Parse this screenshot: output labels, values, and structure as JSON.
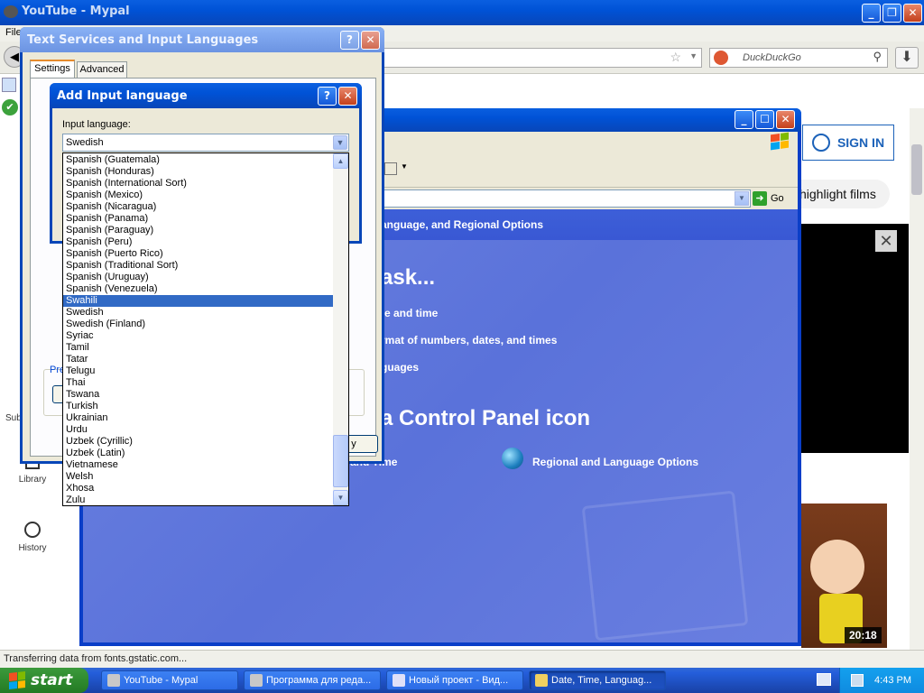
{
  "browser": {
    "title": "YouTube - Mypal",
    "menu_file": "File",
    "search_placeholder": "DuckDuckGo",
    "status": "Transferring data from fonts.gstatic.com...",
    "sign_in": "SIGN IN",
    "chip": "highlight films",
    "video_duration": "20:18",
    "nav": {
      "subscriptions": "Sub",
      "library": "Library",
      "history": "History"
    }
  },
  "control_panel": {
    "breadcrumb": "anguage, and Regional Options",
    "go": "Go",
    "heading_task": "ask...",
    "task_link_1": "te and time",
    "task_link_2": "rmat of numbers, dates, and times",
    "task_link_3": "guages",
    "heading_icon": "a Control Panel icon",
    "icon_link_left": "and Time",
    "icon_link_right": "Regional and Language Options"
  },
  "text_services": {
    "title": "Text Services and Input Languages",
    "tab_settings": "Settings",
    "tab_advanced": "Advanced",
    "pref_label": "Pre",
    "apply": "y"
  },
  "add_language": {
    "title": "Add Input language",
    "label": "Input language:",
    "selected_value": "Swedish",
    "highlighted": "Swahili",
    "options": [
      "Spanish (Guatemala)",
      "Spanish (Honduras)",
      "Spanish (International Sort)",
      "Spanish (Mexico)",
      "Spanish (Nicaragua)",
      "Spanish (Panama)",
      "Spanish (Paraguay)",
      "Spanish (Peru)",
      "Spanish (Puerto Rico)",
      "Spanish (Traditional Sort)",
      "Spanish (Uruguay)",
      "Spanish (Venezuela)",
      "Swahili",
      "Swedish",
      "Swedish (Finland)",
      "Syriac",
      "Tamil",
      "Tatar",
      "Telugu",
      "Thai",
      "Tswana",
      "Turkish",
      "Ukrainian",
      "Urdu",
      "Uzbek (Cyrillic)",
      "Uzbek (Latin)",
      "Vietnamese",
      "Welsh",
      "Xhosa",
      "Zulu"
    ]
  },
  "taskbar": {
    "start": "start",
    "tasks": [
      {
        "label": "YouTube - Mypal",
        "active": false,
        "icon_color": "#c8c8c8"
      },
      {
        "label": "Программа для реда...",
        "active": false,
        "icon_color": "#c8c8c8"
      },
      {
        "label": "Новый проект - Вид...",
        "active": false,
        "icon_color": "#e0e0f8"
      },
      {
        "label": "Date, Time, Languag...",
        "active": true,
        "icon_color": "#f0d060"
      }
    ],
    "clock": "4:43 PM"
  }
}
